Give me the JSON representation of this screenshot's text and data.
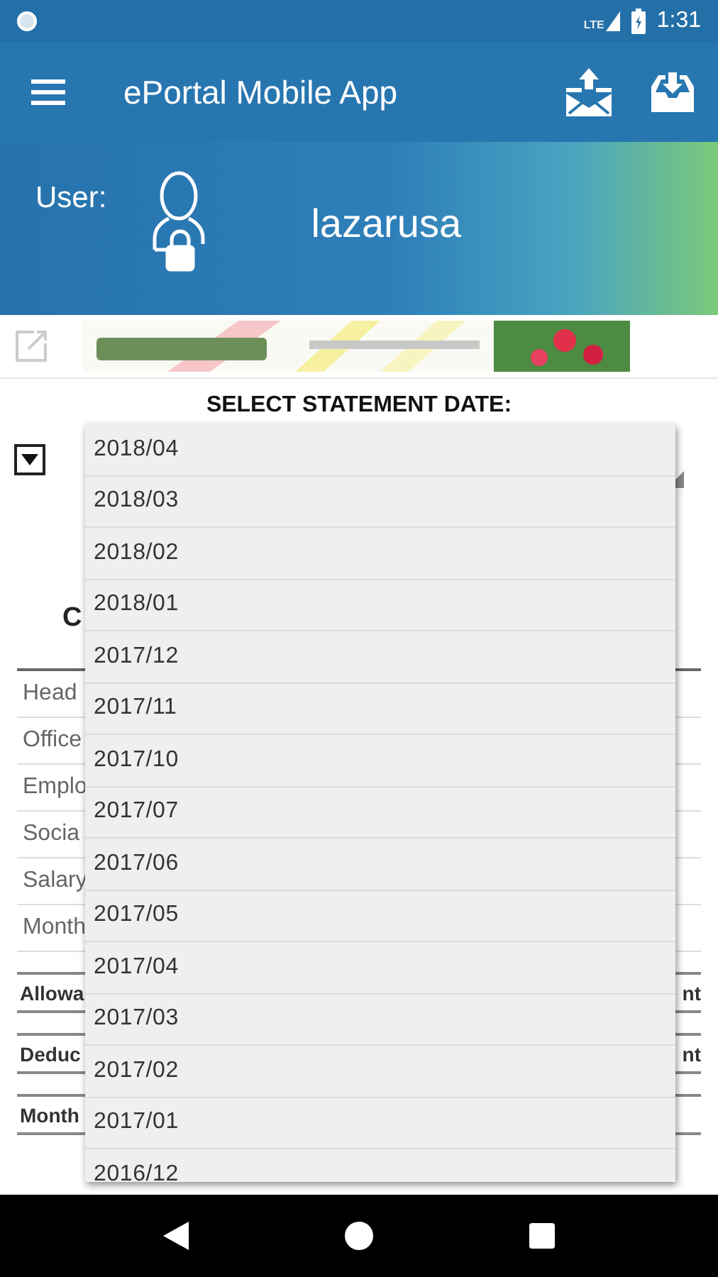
{
  "status_bar": {
    "network": "LTE",
    "time": "1:31"
  },
  "app_bar": {
    "title": "ePortal Mobile App"
  },
  "user": {
    "label": "User:",
    "name": "lazarusa"
  },
  "statement": {
    "title": "SELECT STATEMENT DATE:",
    "heading": "C",
    "rows": [
      {
        "kind": "plain",
        "label": "Head"
      },
      {
        "kind": "plain",
        "label": "Office"
      },
      {
        "kind": "plain",
        "label": "Emplo"
      },
      {
        "kind": "plain",
        "label": "Socia"
      },
      {
        "kind": "plain",
        "label": "Salary"
      },
      {
        "kind": "plain",
        "label": "Month"
      },
      {
        "kind": "header",
        "label": "Allowa",
        "right": "nt"
      },
      {
        "kind": "header",
        "label": "Deduc",
        "right": "nt"
      },
      {
        "kind": "header",
        "label": "Month"
      }
    ]
  },
  "dropdown": {
    "options": [
      "2018/04",
      "2018/03",
      "2018/02",
      "2018/01",
      "2017/12",
      "2017/11",
      "2017/10",
      "2017/07",
      "2017/06",
      "2017/05",
      "2017/04",
      "2017/03",
      "2017/02",
      "2017/01",
      "2016/12"
    ]
  }
}
